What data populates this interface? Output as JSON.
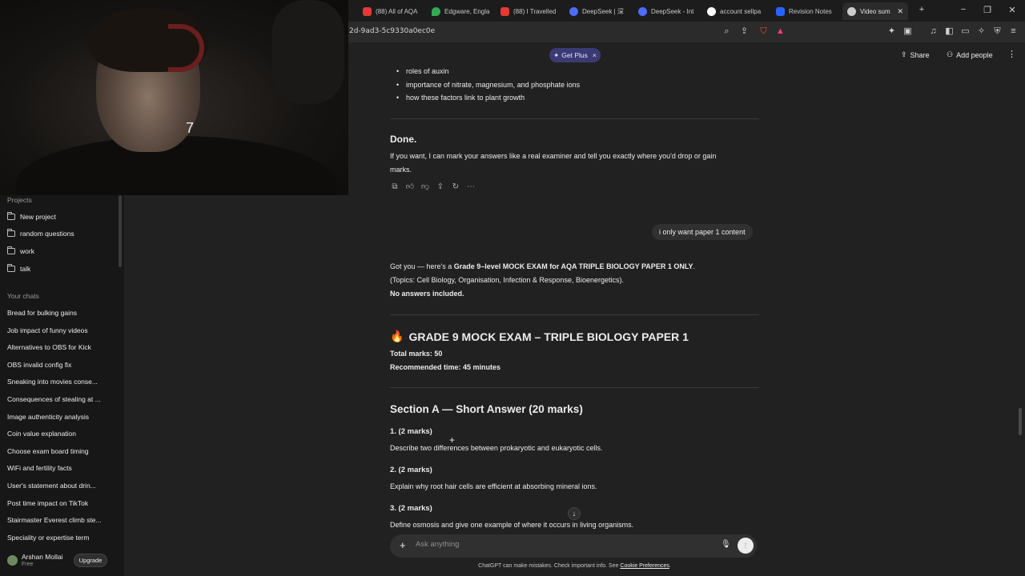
{
  "browser": {
    "tabs": [
      {
        "label": "(88) All of AQA",
        "color": "#e53935"
      },
      {
        "label": "Edgware, Engla",
        "color": "#34a853"
      },
      {
        "label": "(88) I Travelled",
        "color": "#e53935"
      },
      {
        "label": "DeepSeek | 深",
        "color": "#4d6bfe"
      },
      {
        "label": "DeepSeek - Int",
        "color": "#4d6bfe"
      },
      {
        "label": "account sellpa",
        "color": "#ffffff"
      },
      {
        "label": "Revision Notes",
        "color": "#2962ff"
      },
      {
        "label": "Video sum",
        "color": "#cccccc"
      }
    ],
    "url": "2d-9ad3-5c9330a0ec0e"
  },
  "sidebar": {
    "projects_label": "Projects",
    "projects": [
      "New project",
      "random questions",
      "work",
      "talk"
    ],
    "chats_label": "Your chats",
    "chats": [
      "Bread for bulking gains",
      "Job impact of funny videos",
      "Alternatives to OBS for Kick",
      "OBS invalid config fix",
      "Sneaking into movies conse...",
      "Consequences of stealing at ...",
      "Image authenticity analysis",
      "Coin value explanation",
      "Choose exam board timing",
      "WiFi and fertility facts",
      "User's statement about drin...",
      "Post time impact on TikTok",
      "Stairmaster Everest climb ste...",
      "Speciality or expertise term"
    ],
    "user": {
      "name": "Arshan Mollai",
      "plan": "Free",
      "upgrade": "Upgrade"
    }
  },
  "header": {
    "get_plus": "Get Plus",
    "share": "Share",
    "add_people": "Add people"
  },
  "chat": {
    "bullets": [
      "roles of auxin",
      "importance of nitrate, magnesium, and phosphate ions",
      "how these factors link to plant growth"
    ],
    "done_heading": "Done.",
    "done_text_1": "If you want, I can mark your answers like a real examiner and tell you exactly where you'd drop or gain",
    "done_text_2": "marks.",
    "user_message": "i only want paper 1 content",
    "reply_intro_1": "Got you — here's a ",
    "reply_intro_bold": "Grade 9–level MOCK EXAM for AQA TRIPLE BIOLOGY PAPER 1 ONLY",
    "reply_intro_2": ".",
    "reply_topics": "(Topics: Cell Biology, Organisation, Infection & Response, Bioenergetics).",
    "reply_no_answers": "No answers included.",
    "exam_emoji": "🔥",
    "exam_title": "GRADE 9 MOCK EXAM – TRIPLE BIOLOGY PAPER 1",
    "total_marks": "Total marks: 50",
    "recommended_time": "Recommended time: 45 minutes",
    "section_a": "Section A — Short Answer (20 marks)",
    "questions": [
      {
        "head": "1. (2 marks)",
        "text": "Describe two differences between prokaryotic and eukaryotic cells."
      },
      {
        "head": "2. (2 marks)",
        "text": "Explain why root hair cells are efficient at absorbing mineral ions."
      },
      {
        "head": "3. (2 marks)",
        "text": "Define osmosis and give one example of where it occurs in living organisms."
      }
    ]
  },
  "composer": {
    "placeholder": "Ask anything"
  },
  "footer": {
    "disclaimer": "ChatGPT can make mistakes. Check important info. See ",
    "link": "Cookie Preferences",
    "end": "."
  }
}
